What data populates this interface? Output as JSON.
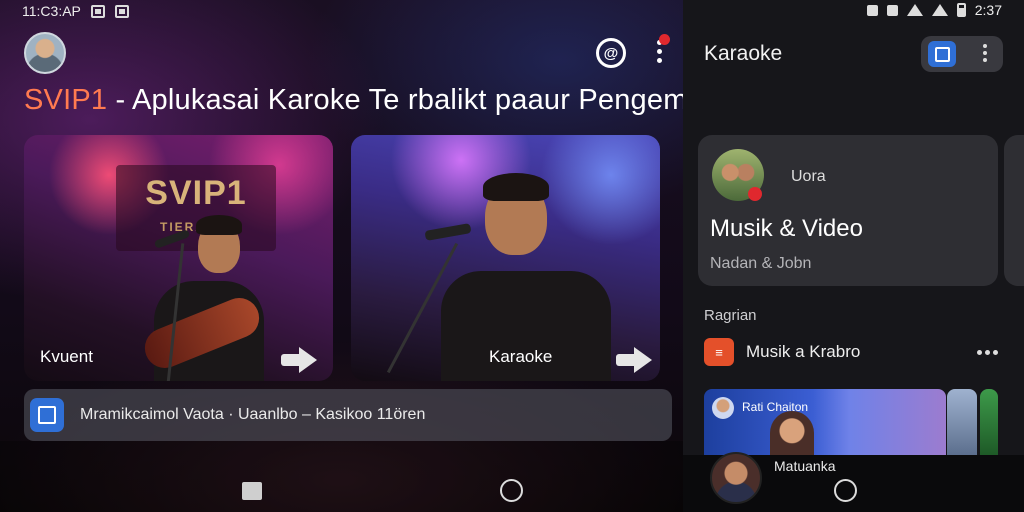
{
  "left": {
    "status": {
      "time": "11:C3:AP"
    },
    "title_accent": "SVIP1",
    "title_rest": " - Aplukasai Karoke Te rbalikt paaur Pengemar Musik",
    "cards": [
      {
        "label": "Kvuent",
        "sign_text": "SVIP1",
        "sign_sub": "TIERADIE"
      },
      {
        "label": "Karaoke"
      }
    ],
    "now_playing": "Mramikcaimol Vaota  · Uaanlbo – Kasikoo 11ören"
  },
  "right": {
    "status": {
      "time": "2:37"
    },
    "title": "Karaoke",
    "feature": {
      "user": "Uora",
      "title": "Musik & Video",
      "subtitle": "Nadan & Jobn"
    },
    "section_label": "Ragrian",
    "list_item": {
      "icon_text": "≡",
      "label": "Musik a Krabro"
    },
    "banner": {
      "text": "Rati Chaiton"
    },
    "user_chip": {
      "name": "Matuanka"
    }
  }
}
